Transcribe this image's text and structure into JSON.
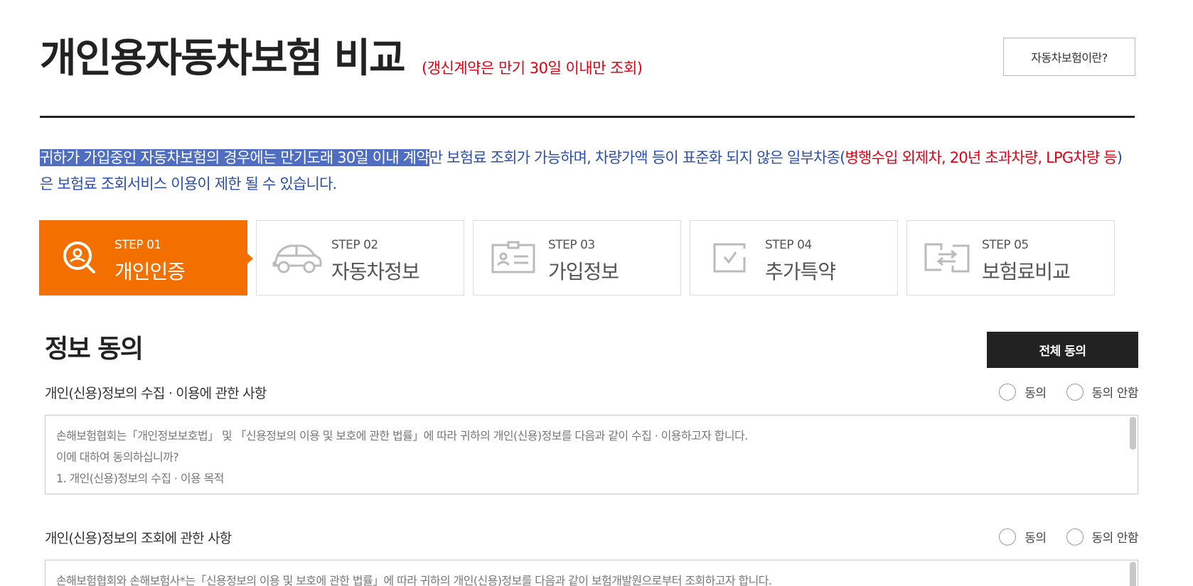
{
  "header": {
    "title": "개인용자동차보험 비교",
    "title_note": "(갱신계약은 만기 30일 이내만 조회)",
    "info_button": "자동차보험이란?"
  },
  "notice": {
    "highlighted": "귀하가 가입중인 자동차보험의 경우에는 만기도래 30일 이내 계약",
    "text_1": "만 보험료 조회가 가능하며, 차량가액 등이 표준화 되지 않은 일부차종(",
    "red": "병행수입 외제차, 20년 초과차량, LPG차량 등",
    "text_2": ")은 보험료 조회서비스 이용이 제한 될 수 있습니다."
  },
  "steps": [
    {
      "num": "STEP 01",
      "label": "개인인증",
      "icon": "user-search-icon",
      "active": true
    },
    {
      "num": "STEP 02",
      "label": "자동차정보",
      "icon": "car-icon",
      "active": false
    },
    {
      "num": "STEP 03",
      "label": "가입정보",
      "icon": "id-card-icon",
      "active": false
    },
    {
      "num": "STEP 04",
      "label": "추가특약",
      "icon": "checkbox-icon",
      "active": false
    },
    {
      "num": "STEP 05",
      "label": "보험료비교",
      "icon": "compare-icon",
      "active": false
    }
  ],
  "agreement": {
    "title": "정보 동의",
    "agree_all_button": "전체 동의",
    "radio_agree": "동의",
    "radio_disagree": "동의 안함",
    "terms": [
      {
        "label": "개인(신용)정보의 수집 · 이용에 관한 사항",
        "lines": [
          "손해보험협회는「개인정보보호법」 및 「신용정보의 이용 및 보호에 관한 법률」에 따라 귀하의 개인(신용)정보를 다음과 같이 수집 · 이용하고자 합니다.",
          "이에 대하여 동의하십니까?",
          "1. 개인(신용)정보의 수집 · 이용 목적"
        ]
      },
      {
        "label": "개인(신용)정보의 조회에 관한 사항",
        "lines": [
          "손해보험협회와 손해보험사*는「신용정보의 이용 및 보호에 관한 법률」에 따라 귀하의 개인(신용)정보를 다음과 같이 보험개발원으로부터 조회하고자 합니다."
        ]
      }
    ]
  },
  "colors": {
    "accent": "#f26f00",
    "notice_blue": "#2b4eb3",
    "warning_red": "#e60012",
    "dark_button": "#222222"
  }
}
